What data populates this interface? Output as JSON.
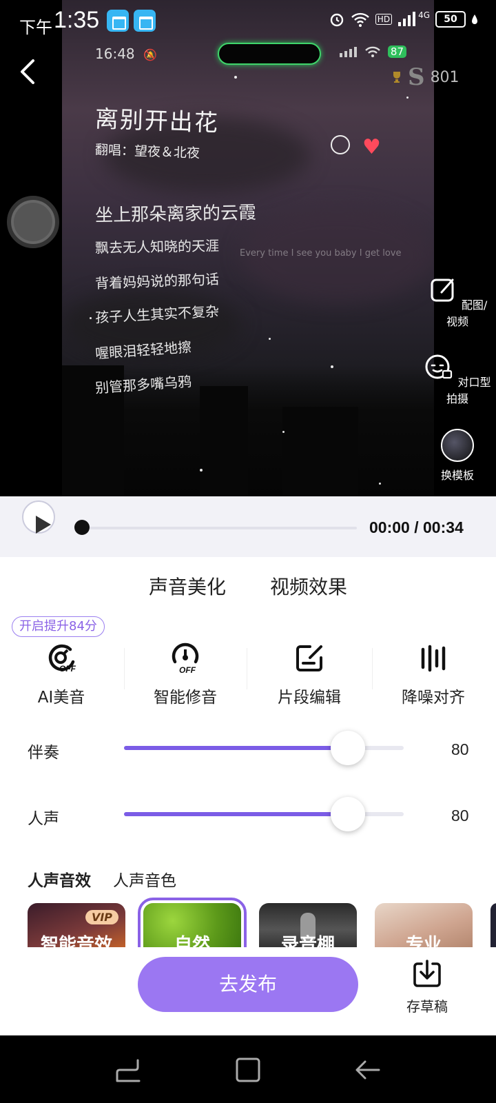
{
  "status_bar": {
    "time_prefix": "下午",
    "time": "1:35",
    "network": "HD",
    "signal": "4G",
    "battery": "50"
  },
  "preview": {
    "inner_status": {
      "time": "16:48",
      "battery": "87"
    },
    "score": "801",
    "song_title": "离别开出花",
    "singer": "翻唱：望夜＆北夜",
    "lyrics": [
      "坐上那朵离家的云霞",
      "飘去无人知晓的天涯",
      "背着妈妈说的那句话",
      "孩子人生其实不复杂",
      "喔眼泪轻轻地擦",
      "别管那多嘴乌鸦"
    ],
    "faint_lyric": "Every time I see you baby I get love",
    "side_tools": [
      {
        "label": "配图/视频",
        "icon": "edit-icon"
      },
      {
        "label": "对口型拍摄",
        "icon": "lipsync-camera-icon"
      },
      {
        "label": "换模板",
        "icon": "template-thumbnail"
      }
    ]
  },
  "player": {
    "time": "00:00 / 00:34",
    "progress": 0
  },
  "tabs": [
    {
      "label": "声音美化",
      "active": true
    },
    {
      "label": "视频效果",
      "active": false
    }
  ],
  "badge": "开启提升84分",
  "tools": [
    {
      "label": "AI美音",
      "icon": "ai-off-icon"
    },
    {
      "label": "智能修音",
      "icon": "tune-off-icon"
    },
    {
      "label": "片段编辑",
      "icon": "segment-edit-icon"
    },
    {
      "label": "降噪对齐",
      "icon": "noise-bars-icon"
    }
  ],
  "sliders": [
    {
      "label": "伴奏",
      "value": "80",
      "fraction": 0.8
    },
    {
      "label": "人声",
      "value": "80",
      "fraction": 0.8
    }
  ],
  "subtabs": [
    {
      "label": "人声音效",
      "active": true
    },
    {
      "label": "人声音色",
      "active": false
    }
  ],
  "effects": [
    {
      "name": "智能音效",
      "vip": "VIP",
      "selected": false
    },
    {
      "name": "自然",
      "selected": true
    },
    {
      "name": "录音棚",
      "selected": false
    },
    {
      "name": "专业",
      "selected": false
    }
  ],
  "actions": {
    "publish": "去发布",
    "draft": "存草稿"
  },
  "colors": {
    "accent": "#9b77f2",
    "slider_fill": "#7b5ce6",
    "tab_underline": "#ffd63a"
  }
}
